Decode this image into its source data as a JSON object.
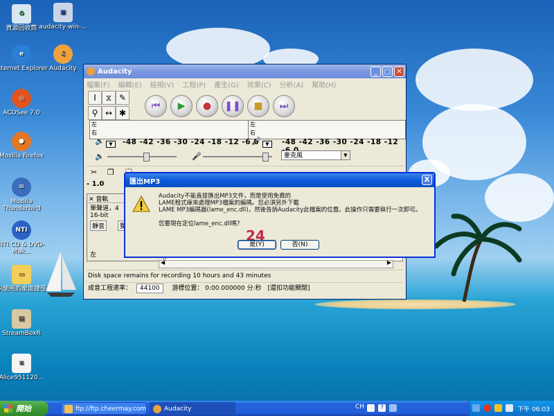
{
  "desktop": {
    "icons": [
      {
        "label": "資源回收筒"
      },
      {
        "label": "audacity-win-..."
      },
      {
        "label": "Internet Explorer"
      },
      {
        "label": "Audacity"
      },
      {
        "label": "ACDSee 7.0"
      },
      {
        "label": "Mozilla Firefox"
      },
      {
        "label": "Mozilla Thunderbird"
      },
      {
        "label": "NTI CD & DVD-Mak..."
      },
      {
        "label": "未使用的桌面捷徑"
      },
      {
        "label": "StreamBoxR"
      },
      {
        "label": "Alice951120..."
      }
    ]
  },
  "window": {
    "title": "Audacity",
    "menu": [
      "檔案(F)",
      "編輯(E)",
      "檢視(V)",
      "工程(P)",
      "產生(G)",
      "效果(C)",
      "分析(A)",
      "幫助(H)"
    ],
    "meter_left_top": "左",
    "meter_left_bottom": "右",
    "meter_right_top": "左",
    "meter_right_bottom": "右",
    "meter_scale": "-48 -42 -36 -30 -24 -18 -12 -6 0",
    "meter_scale_right": "-48 -42 -36 -30 -24 -18 -12 -6 0",
    "input_select": "麥克風",
    "ruler_value": "- 1.0",
    "track": {
      "name": "音軌",
      "line1": "單聲道，4",
      "line2": "16-bit",
      "mute": "靜音",
      "solo": "獨",
      "pan_left": "左"
    },
    "status": "Disk space remains for recording 10 hours and 43 minutes",
    "rate_label": "成音工程速率：",
    "rate_value": "44100",
    "position_label": "游標位置：",
    "position_value": "0:00.000000 分:秒",
    "snap_label": "[還扣功能關閉]"
  },
  "dialog": {
    "title": "匯出MP3",
    "lines": [
      "Audacity不能直接匯出MP3文件，而是使用免費的",
      "LAME程式庫來處理MP3檔案的編碼。您必須另外下載",
      "LAME MP3編碼器(lame_enc.dll)，然後告訴Audacity此檔案的位置。此操作只需要執行一次即可。"
    ],
    "question": "您要現在定位lame_enc.dll嗎？",
    "step_number": "24",
    "yes_label": "是(Y)",
    "no_label": "否(N)",
    "close_label": "X"
  },
  "taskbar": {
    "start_label": "開始",
    "tasks": [
      "ftp://ftp.cheermay.com...",
      "Audacity"
    ],
    "lang": "CH",
    "clock": "下午 06:03"
  }
}
